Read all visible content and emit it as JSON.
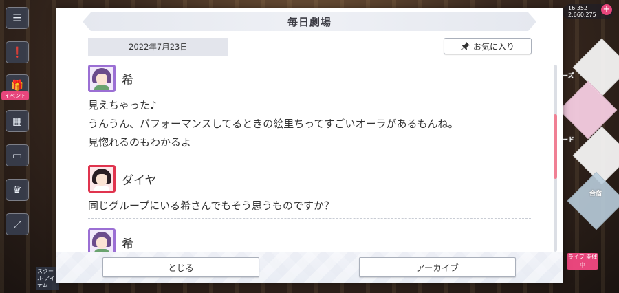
{
  "background": {
    "right_pill_line1": "16,352",
    "right_pill_line2": "2,660,275",
    "plus_label": "+",
    "rail_badge": "イベント",
    "rail_caption": "スクール アイテム",
    "diamond_labels": [
      "ーズ",
      "ード",
      "合宿"
    ],
    "corner_banner": "ライブ 開催中"
  },
  "modal": {
    "title": "毎日劇場",
    "date": "2022年7月23日",
    "favorite_label": "お気に入り",
    "entries": [
      {
        "speaker": "希",
        "avatar_color": "#9b6fd4",
        "lines": [
          "見えちゃった♪",
          "うんうん、パフォーマンスしてるときの絵里ちってすごいオーラがあるもんね。",
          "見惚れるのもわかるよ"
        ]
      },
      {
        "speaker": "ダイヤ",
        "avatar_color": "#e0344e",
        "lines": [
          "同じグループにいる希さんでもそう思うものですか？"
        ]
      },
      {
        "speaker": "希",
        "avatar_color": "#9b6fd4",
        "lines": []
      }
    ],
    "close_label": "とじる",
    "archive_label": "アーカイブ",
    "accent_color": "#f08094"
  }
}
